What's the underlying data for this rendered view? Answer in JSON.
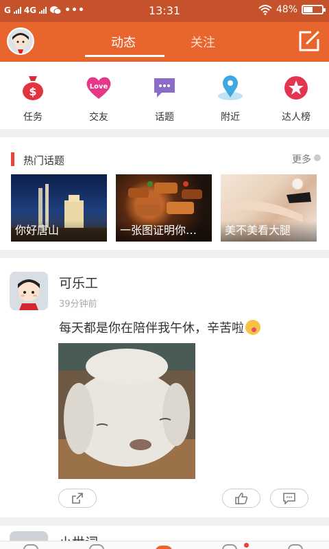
{
  "status_bar": {
    "carrier": "G",
    "network": "4G",
    "time": "13:31",
    "battery": "48%"
  },
  "header": {
    "tabs": [
      {
        "label": "动态",
        "active": true
      },
      {
        "label": "关注",
        "active": false
      }
    ]
  },
  "quick_menu": [
    {
      "label": "任务",
      "icon": "money-bag-icon"
    },
    {
      "label": "交友",
      "icon": "love-heart-icon",
      "badge_text": "Love"
    },
    {
      "label": "话题",
      "icon": "speech-bubble-icon"
    },
    {
      "label": "附近",
      "icon": "location-pin-icon"
    },
    {
      "label": "达人榜",
      "icon": "star-badge-icon"
    }
  ],
  "hot_topics": {
    "title": "热门话题",
    "more": "更多",
    "items": [
      {
        "label": "你好唐山"
      },
      {
        "label": "一张图证明你…"
      },
      {
        "label": "美不美看大腿"
      }
    ]
  },
  "post": {
    "username": "可乐工",
    "time_ago": "39分钟前",
    "text": "每天都是你在陪伴我午休，辛苦啦"
  },
  "next_post": {
    "username": "小世词"
  },
  "colors": {
    "brand": "#e8652e",
    "status_bar": "#c5522a",
    "accent_red": "#e8443a"
  }
}
